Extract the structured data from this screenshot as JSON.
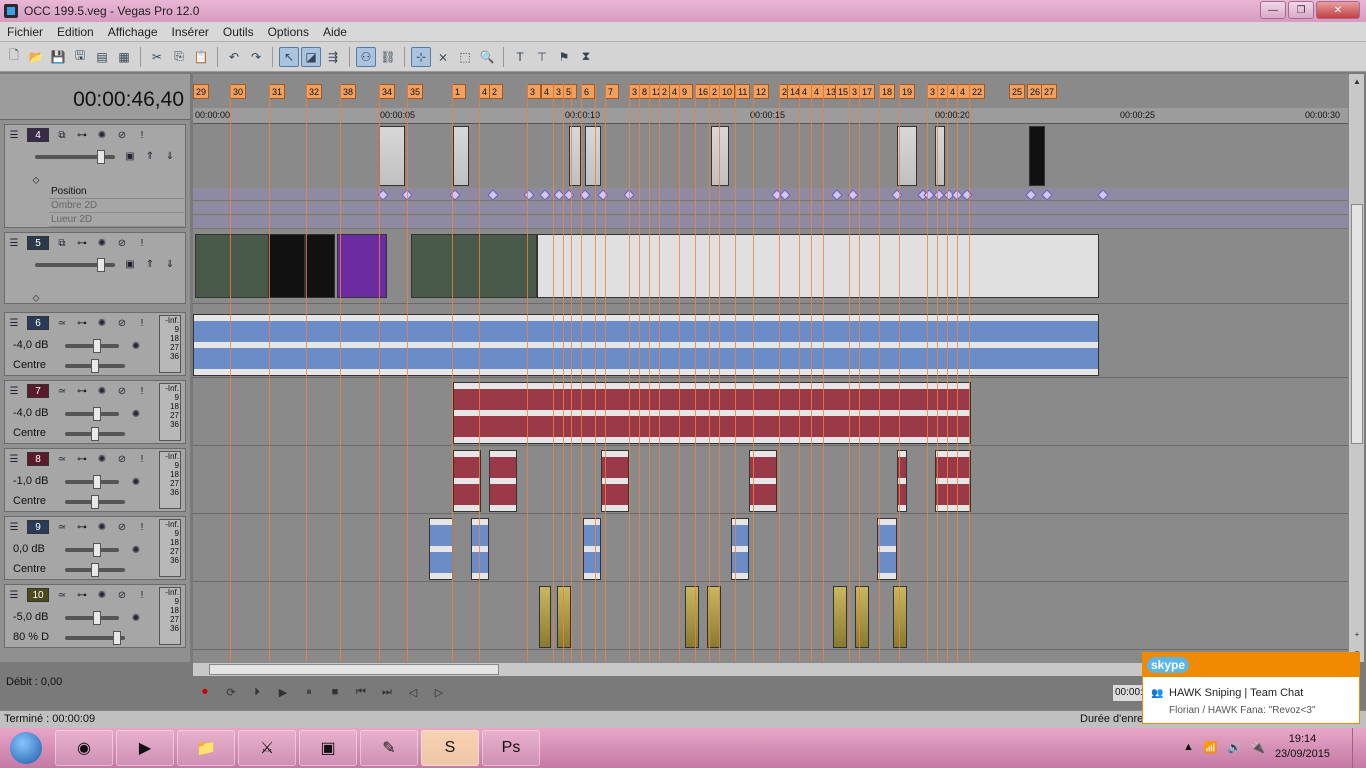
{
  "window": {
    "title": "OCC 199.5.veg - Vegas Pro 12.0"
  },
  "menu": [
    "Fichier",
    "Edition",
    "Affichage",
    "Insérer",
    "Outils",
    "Options",
    "Aide"
  ],
  "timecode": "00:00:46,40",
  "ruler_ticks": [
    "00:00:00",
    "00:00:05",
    "00:00:10",
    "00:00:15",
    "00:00:20",
    "00:00:25",
    "00:00:30"
  ],
  "markers": [
    "29",
    "30",
    "31",
    "32",
    "38",
    "34",
    "35",
    "1",
    "4",
    "2",
    "3",
    "4",
    "3",
    "5",
    "6",
    "7",
    "3",
    "8",
    "12",
    "2",
    "4",
    "9",
    "16",
    "2",
    "10",
    "11",
    "12",
    "2",
    "14",
    "4",
    "4",
    "13",
    "15",
    "3",
    "17",
    "18",
    "19",
    "3",
    "2",
    "4",
    "4",
    "22",
    "25",
    "26",
    "27"
  ],
  "tracks": [
    {
      "num": "4",
      "color": "#3a2a4a",
      "kind": "video",
      "fx": [
        "Position",
        "Ombre 2D",
        "Lueur 2D"
      ]
    },
    {
      "num": "5",
      "color": "#2a3a4a",
      "kind": "video"
    },
    {
      "num": "6",
      "color": "#2a3a5a",
      "kind": "audio",
      "vol": "-4,0 dB",
      "pan": "Centre"
    },
    {
      "num": "7",
      "color": "#5a1a2a",
      "kind": "audio",
      "vol": "-4,0 dB",
      "pan": "Centre"
    },
    {
      "num": "8",
      "color": "#5a1a2a",
      "kind": "audio",
      "vol": "-1,0 dB",
      "pan": "Centre"
    },
    {
      "num": "9",
      "color": "#2a3a5a",
      "kind": "audio",
      "vol": "0,0 dB",
      "pan": "Centre"
    },
    {
      "num": "10",
      "color": "#4a4a1a",
      "kind": "audio",
      "vol": "-5,0 dB",
      "pan": "80 % D"
    }
  ],
  "vu_labels": [
    "-Inf.",
    "9",
    "18",
    "27",
    "36"
  ],
  "rate": "Débit : 0,00",
  "status_message": "Terminé : 00:00:09",
  "duration_label": "Durée d'enre",
  "time_box": "00:00:",
  "skype": {
    "brand": "skype",
    "chat": "HAWK Sniping | Team Chat",
    "message": "Florian / HAWK Fana: \"Revoz<3\""
  },
  "taskbar": {
    "time": "19:14",
    "date": "23/09/2015"
  }
}
